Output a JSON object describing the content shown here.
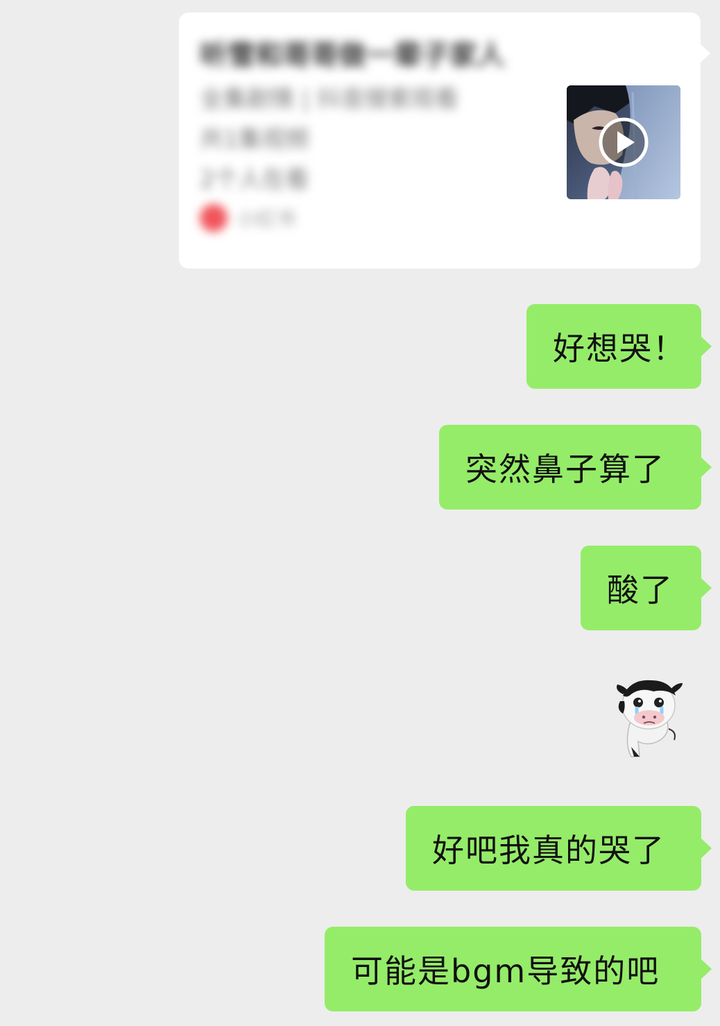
{
  "shared_card": {
    "title": "听雪和哥哥做一辈子家人",
    "subtitle": "全集剧情 | 抖音搜索观看",
    "line3": "共1集视频",
    "line4": "2个人在看",
    "source_label": "小红书",
    "thumbnail_icon": "play-icon"
  },
  "messages": [
    {
      "text": "好想哭！"
    },
    {
      "text": "突然鼻子算了"
    },
    {
      "text": "酸了"
    },
    {
      "text": "好吧我真的哭了"
    },
    {
      "text": "可能是bgm导致的吧"
    }
  ],
  "sticker": {
    "icon": "crying-cow-sticker"
  },
  "colors": {
    "background": "#ededed",
    "bubble_green": "#95ec69",
    "card_white": "#ffffff"
  }
}
